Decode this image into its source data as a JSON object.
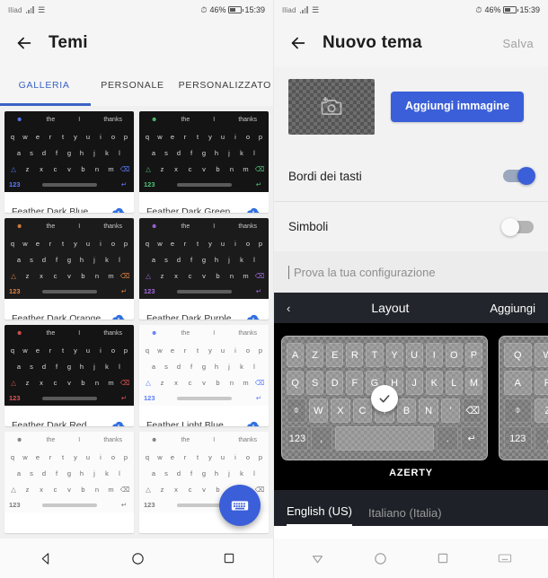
{
  "status_bar": {
    "carrier": "Iliad",
    "battery_percent": "46%",
    "time": "15:39",
    "icons": [
      "signal-icon",
      "wifi-icon",
      "alarm-icon",
      "battery-icon"
    ]
  },
  "left_screen": {
    "title": "Temi",
    "back_icon": "back-arrow-icon",
    "tabs": [
      {
        "label": "GALLERIA",
        "active": true
      },
      {
        "label": "PERSONALE",
        "active": false
      },
      {
        "label": "PERSONALIZZATO",
        "active": false
      }
    ],
    "keyboard_preview": {
      "suggestions": [
        "the",
        "I",
        "thanks"
      ],
      "row1": [
        "q",
        "w",
        "e",
        "r",
        "t",
        "y",
        "u",
        "i",
        "o",
        "p"
      ],
      "row2": [
        "a",
        "s",
        "d",
        "f",
        "g",
        "h",
        "j",
        "k",
        "l"
      ],
      "row3": [
        "z",
        "x",
        "c",
        "v",
        "b",
        "n",
        "m"
      ],
      "num_key": "123",
      "shift_icon": "shift-icon",
      "backspace_icon": "backspace-icon",
      "enter_icon": "enter-icon"
    },
    "themes": [
      {
        "name": "Feather Dark Blue",
        "style": "dark",
        "accent": "#5b7cff",
        "download_icon": "download-cloud-icon"
      },
      {
        "name": "Feather Dark Green",
        "style": "dark",
        "accent": "#52c27a",
        "download_icon": "download-cloud-icon"
      },
      {
        "name": "Feather Dark Orange",
        "style": "dark2",
        "accent": "#e08040",
        "download_icon": "download-cloud-icon"
      },
      {
        "name": "Feather Dark Purple",
        "style": "dark2",
        "accent": "#a368e0",
        "download_icon": "download-cloud-icon"
      },
      {
        "name": "Feather Dark Red",
        "style": "dark",
        "accent": "#e05252",
        "download_icon": "download-cloud-icon"
      },
      {
        "name": "Feather Light Blue",
        "style": "light",
        "accent": "#5b7cff",
        "download_icon": "download-cloud-icon"
      },
      {
        "name": "",
        "style": "light",
        "accent": "#7a7a7a",
        "download_icon": "download-cloud-icon"
      },
      {
        "name": "",
        "style": "light",
        "accent": "#7a7a7a",
        "download_icon": "download-cloud-icon"
      }
    ],
    "fab": {
      "icon": "keyboard-icon",
      "color": "#3b5fd9"
    },
    "nav": [
      "back-triangle-icon",
      "home-circle-icon",
      "recents-square-icon"
    ]
  },
  "right_screen": {
    "title": "Nuovo tema",
    "back_icon": "back-arrow-icon",
    "save_label": "Salva",
    "image_placeholder_icon": "add-photo-icon",
    "add_image_button": "Aggiungi immagine",
    "settings": [
      {
        "label": "Bordi dei tasti",
        "state": "on"
      },
      {
        "label": "Simboli",
        "state": "off"
      }
    ],
    "test_field_placeholder": "Prova la tua configurazione",
    "layout_bar": {
      "back_icon": "chevron-left-icon",
      "title": "Layout",
      "action": "Aggiungi"
    },
    "layouts": [
      {
        "name": "AZERTY",
        "selected": true,
        "row1": [
          "A",
          "Z",
          "E",
          "R",
          "T",
          "Y",
          "U",
          "I",
          "O",
          "P"
        ],
        "row2": [
          "Q",
          "S",
          "D",
          "F",
          "G",
          "H",
          "J",
          "K",
          "L",
          "M"
        ],
        "row3": [
          "W",
          "X",
          "C",
          "V",
          "B",
          "N",
          "'"
        ],
        "num_key": "123",
        "comma": ",",
        "period": ".",
        "shift_icon": "shift-icon",
        "backspace_icon": "backspace-icon",
        "enter_icon": "enter-icon",
        "check_icon": "check-icon"
      },
      {
        "name": "",
        "selected": false,
        "row1": [
          "Q",
          "W"
        ],
        "row2": [
          "A",
          "R"
        ],
        "row3": [
          "Z"
        ],
        "num_key": "123",
        "comma": ",",
        "shift_icon": "shift-icon"
      }
    ],
    "languages": [
      {
        "label": "English (US)",
        "active": true
      },
      {
        "label": "Italiano (Italia)",
        "active": false
      }
    ],
    "nav": [
      "back-triangle-icon",
      "home-circle-icon",
      "recents-square-icon",
      "keyboard-icon"
    ]
  }
}
